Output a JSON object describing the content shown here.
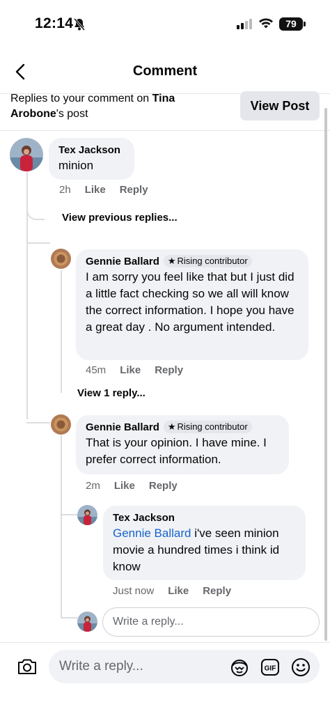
{
  "status_bar": {
    "time": "12:14",
    "battery": "79"
  },
  "header": {
    "title": "Comment"
  },
  "banner": {
    "prefix": "Replies to your comment on ",
    "post_owner_first": "Tina",
    "post_owner_last": "Arobone",
    "suffix": "'s post",
    "view_post_label": "View Post"
  },
  "comments": [
    {
      "author": "Tex Jackson",
      "text": "minion",
      "time": "2h",
      "like_label": "Like",
      "reply_label": "Reply"
    },
    {
      "author": "Gennie Ballard",
      "badge": "Rising contributor",
      "text": "I am sorry you feel like that but I just did a little fact checking so we all will know the correct information.  I hope you have a great day . No argument intended.",
      "time": "45m",
      "like_label": "Like",
      "reply_label": "Reply"
    },
    {
      "author": "Gennie Ballard",
      "badge": "Rising contributor",
      "text": "That is your opinion.  I have mine. I prefer correct information.",
      "time": "2m",
      "like_label": "Like",
      "reply_label": "Reply"
    },
    {
      "author": "Tex Jackson",
      "mention": "Gennie Ballard",
      "text": " i've seen minion movie a hundred times i think id know",
      "time": "Just now",
      "like_label": "Like",
      "reply_label": "Reply"
    }
  ],
  "view_previous_replies": "View previous replies...",
  "view_one_reply": "View 1 reply...",
  "inline_reply_placeholder": "Write a reply...",
  "bottom_bar": {
    "placeholder": "Write a reply...",
    "icons": [
      "camera-icon",
      "avatar-sticker-icon",
      "gif-icon",
      "emoji-icon"
    ],
    "gif_label": "GIF"
  },
  "colors": {
    "mention": "#1763cf",
    "bubble": "#f0f2f5",
    "thread_line": "#dadde1",
    "meta_text": "#65676b"
  }
}
